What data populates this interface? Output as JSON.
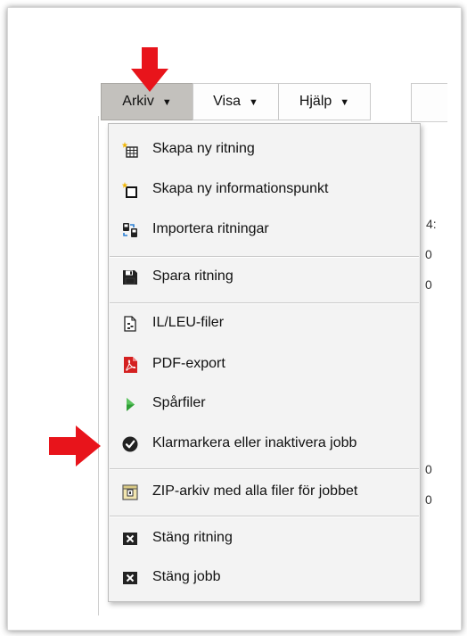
{
  "menubar": {
    "items": [
      {
        "label": "Arkiv",
        "active": true
      },
      {
        "label": "Visa",
        "active": false
      },
      {
        "label": "Hjälp",
        "active": false
      }
    ],
    "caret": "▼"
  },
  "dropdown": {
    "items": [
      {
        "label": "Skapa ny ritning",
        "icon": "new-drawing-icon"
      },
      {
        "label": "Skapa ny informationspunkt",
        "icon": "new-info-point-icon"
      },
      {
        "label": "Importera ritningar",
        "icon": "import-drawings-icon"
      },
      {
        "label": "Spara ritning",
        "icon": "save-icon"
      },
      {
        "label": "IL/LEU-filer",
        "icon": "document-icon"
      },
      {
        "label": "PDF-export",
        "icon": "pdf-icon"
      },
      {
        "label": "Spårfiler",
        "icon": "play-triangle-icon"
      },
      {
        "label": "Klarmarkera eller inaktivera jobb",
        "icon": "checkmark-circle-icon"
      },
      {
        "label": "ZIP-arkiv med alla filer för jobbet",
        "icon": "zip-archive-icon"
      },
      {
        "label": "Stäng ritning",
        "icon": "close-box-icon"
      },
      {
        "label": "Stäng jobb",
        "icon": "close-box-icon"
      }
    ]
  },
  "background_fragments": [
    "4:",
    "0",
    "0",
    "0",
    "0"
  ],
  "colors": {
    "annotation_arrow": "#e8141b",
    "menu_active": "#c3c1bd",
    "dropdown_bg": "#f3f3f3",
    "pdf_red": "#d42020",
    "play_green": "#2e9e34"
  }
}
